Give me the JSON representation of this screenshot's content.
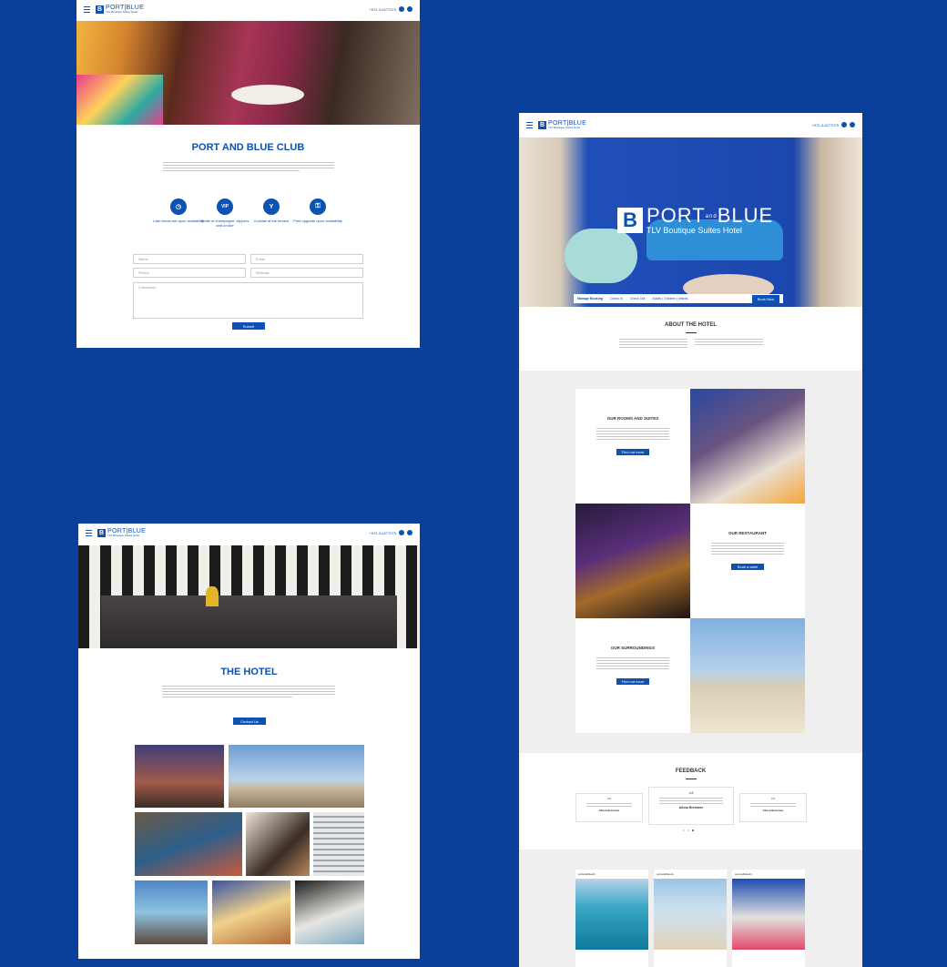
{
  "brand": {
    "logo_mark": "B",
    "name": "PORT|BLUE",
    "tagline": "TLV Boutique Suites Hotel",
    "phone": "+972-3-6277075"
  },
  "club": {
    "title": "PORT AND BLUE CLUB",
    "features": [
      {
        "icon": "clock-icon",
        "glyph": "◷",
        "label": "Late check-out upon availability"
      },
      {
        "icon": "vip-icon",
        "glyph": "VIP",
        "label": "Bottle of champagne, slippers and a robe"
      },
      {
        "icon": "cocktail-icon",
        "glyph": "Y",
        "label": "Cocktail at the terrace"
      },
      {
        "icon": "key-icon",
        "glyph": "⚿",
        "label": "Free upgrade upon availability"
      }
    ],
    "form": {
      "name": "Name",
      "email": "Email",
      "phone": "Phone",
      "birthday": "Birthday",
      "comments": "Comments",
      "submit": "Submit"
    }
  },
  "hotel": {
    "title": "THE HOTEL",
    "button": "Contact Us"
  },
  "home": {
    "hero_name": "PORT",
    "hero_and": "and",
    "hero_name2": "BLUE",
    "hero_sub": "TLV Boutique Suites Hotel",
    "booking": {
      "label": "Manage Booking",
      "checkin": "Check In",
      "checkout": "Check Out",
      "guests": "Adults | Children | Infants",
      "button": "Book Now"
    },
    "about_title": "ABOUT THE HOTEL",
    "rooms_title": "OUR ROOMS AND SUITES",
    "rooms_button": "Find out more",
    "restaurant_title": "OUR RESTAURANT",
    "restaurant_button": "Book a table",
    "surroundings_title": "OUR SURROUNDINGS",
    "surroundings_button": "Find out more",
    "feedback_title": "FEEDBACK",
    "feedback": [
      {
        "rating": "4.6",
        "author": "Alissa Bremmer"
      },
      {
        "rating": "4.8",
        "author": "Alissa Bremmer"
      },
      {
        "rating": "4.6",
        "author": "Alissa Bremmer"
      }
    ],
    "instagram_handle": "portandbluetlv"
  },
  "colors": {
    "background": "#0a3f9c",
    "brand": "#0b52b3"
  }
}
